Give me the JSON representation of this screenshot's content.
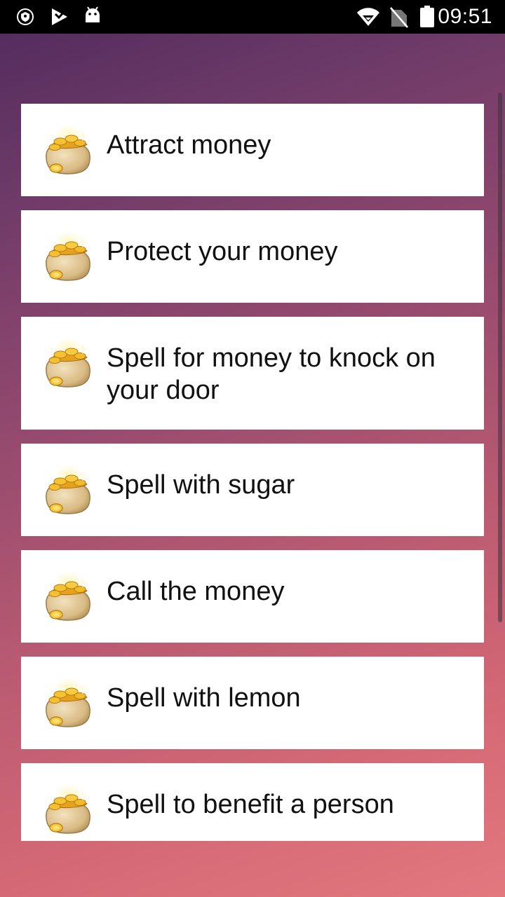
{
  "status_bar": {
    "time": "09:51",
    "icons": [
      "shield-icon",
      "play-icon",
      "android-icon",
      "wifi-icon",
      "no-sim-icon",
      "battery-icon"
    ]
  },
  "items": [
    {
      "label": "Attract money",
      "icon": "money-bag-icon"
    },
    {
      "label": "Protect your money",
      "icon": "money-bag-icon"
    },
    {
      "label": "Spell for money to knock on your door",
      "icon": "money-bag-icon"
    },
    {
      "label": "Spell with sugar",
      "icon": "money-bag-icon"
    },
    {
      "label": "Call the money",
      "icon": "money-bag-icon"
    },
    {
      "label": "Spell with lemon",
      "icon": "money-bag-icon"
    },
    {
      "label": "Spell to benefit a person",
      "icon": "money-bag-icon"
    }
  ],
  "colors": {
    "background_top": "#4f2a5c",
    "background_bottom": "#e4787f",
    "card": "#ffffff",
    "text": "#111111"
  }
}
